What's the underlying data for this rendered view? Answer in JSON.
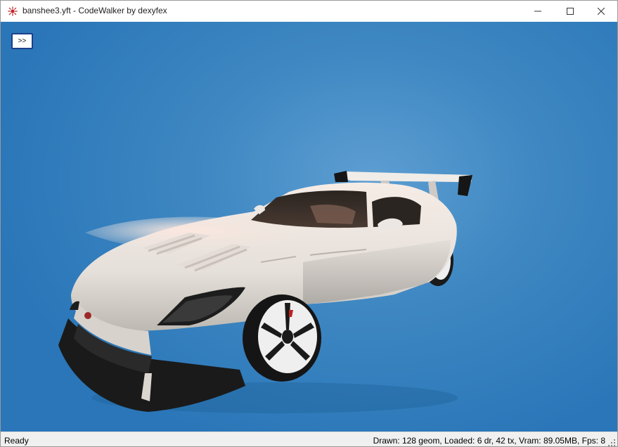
{
  "window": {
    "title": "banshee3.yft - CodeWalker by dexyfex",
    "icon": "codewalker-app-icon",
    "controls": {
      "minimize_icon": "minimize-icon",
      "maximize_icon": "maximize-icon",
      "close_icon": "close-icon"
    }
  },
  "viewport": {
    "toggle_panel_label": ">>",
    "background_color": "#3e87c2",
    "model": "car-model-render"
  },
  "statusbar": {
    "status": "Ready",
    "stats": "Drawn: 128 geom, Loaded: 6 dr, 42 tx, Vram: 89.05MB, Fps: 8",
    "grip_icon": "resize-grip-icon"
  },
  "colors": {
    "accent_border": "#1d3e8a",
    "titlebar": "#ffffff",
    "statusbar": "#f0f0f0"
  }
}
